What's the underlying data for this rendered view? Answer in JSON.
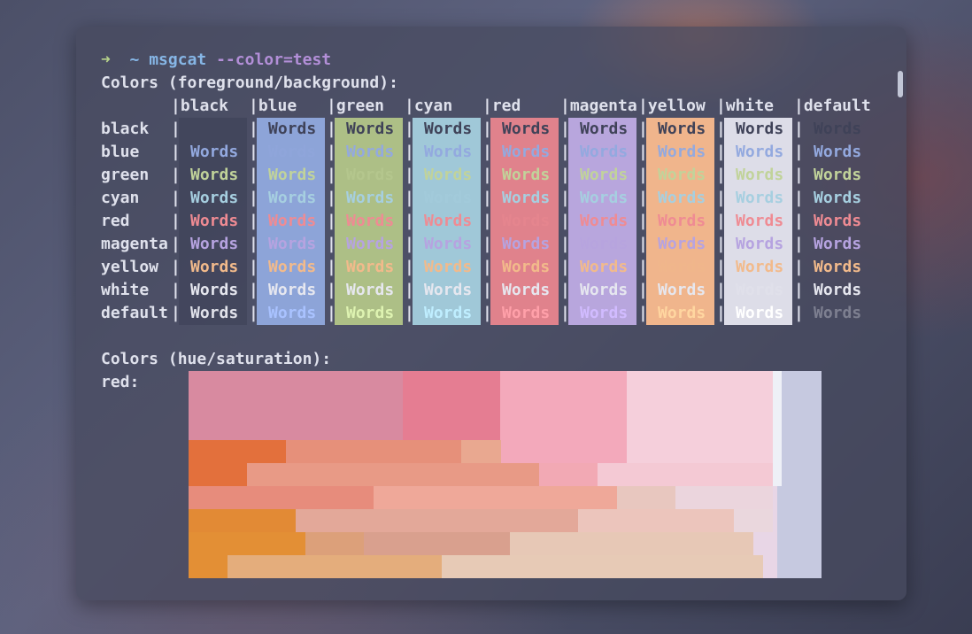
{
  "prompt": {
    "arrow": "➜",
    "tilde": "~",
    "command": "msgcat",
    "argument": "--color=test"
  },
  "section1_title": "Colors (foreground/background):",
  "columns": [
    "black",
    "blue",
    "green",
    "cyan",
    "red",
    "magenta",
    "yellow",
    "white",
    "default"
  ],
  "column_headers": [
    "|black",
    "|blue",
    "|green",
    "|cyan",
    "|red",
    "|magenta",
    "|yellow",
    "|white",
    "|default"
  ],
  "rows": [
    "black",
    "blue",
    "green",
    "cyan",
    "red",
    "magenta",
    "yellow",
    "white",
    "default"
  ],
  "cell_word": "Words",
  "separator": "|",
  "colors": {
    "bg": {
      "black": "#444762",
      "blue": "#8da4d8",
      "green": "#adbf86",
      "cyan": "#a0c8d8",
      "red": "#e0828c",
      "magenta": "#b8a6dd",
      "yellow": "#f0b58c",
      "white": "#dddde8"
    },
    "fg": {
      "black": "#4a4d68",
      "blue": "#93a9df",
      "green": "#c1d39a",
      "cyan": "#a6cfe0",
      "red": "#ef8b93",
      "magenta": "#b6a3e0",
      "yellow": "#f2ba8b",
      "white": "#e6e7ef",
      "default": "#e1e2ea"
    }
  },
  "section2_title": "Colors (hue/saturation):",
  "hue_label": "red:"
}
